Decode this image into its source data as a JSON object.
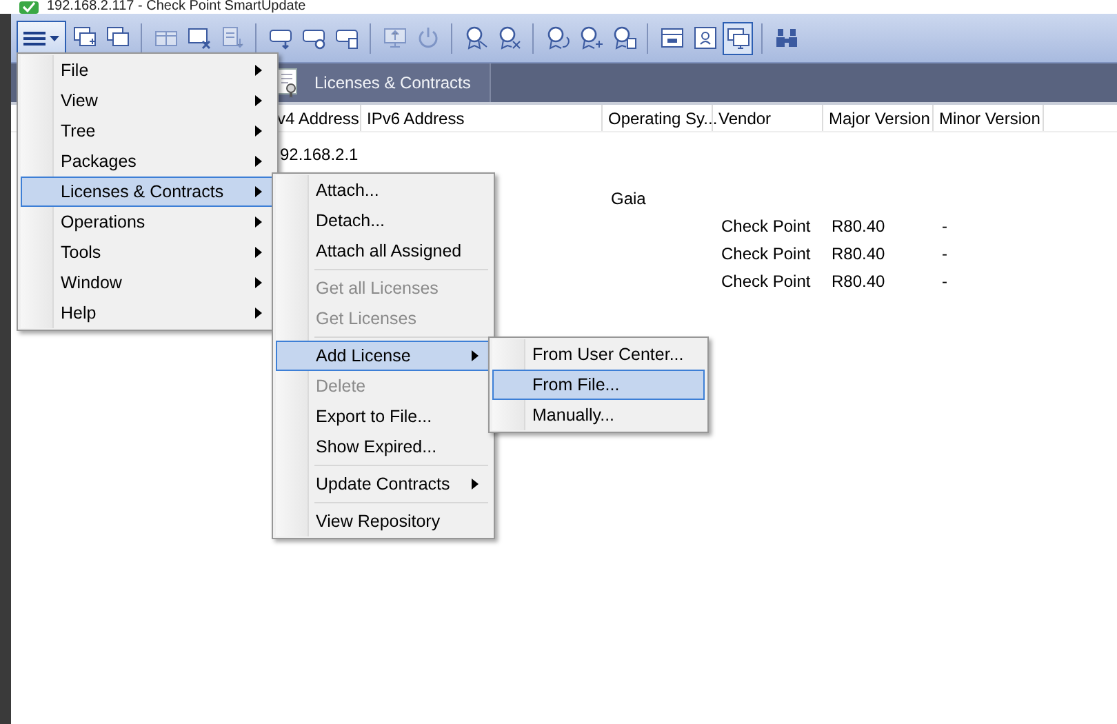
{
  "window": {
    "title": "192.168.2.117 - Check Point SmartUpdate"
  },
  "toolbar": {
    "menu_button": {
      "open": true
    },
    "items": [
      {
        "kind": "button",
        "disabled": false,
        "selected": false
      },
      {
        "kind": "button",
        "disabled": false,
        "selected": false
      },
      {
        "kind": "separator"
      },
      {
        "kind": "button",
        "disabled": true,
        "selected": false
      },
      {
        "kind": "button",
        "disabled": false,
        "selected": false
      },
      {
        "kind": "button",
        "disabled": true,
        "selected": false
      },
      {
        "kind": "separator"
      },
      {
        "kind": "button",
        "disabled": false,
        "selected": false
      },
      {
        "kind": "button",
        "disabled": false,
        "selected": false
      },
      {
        "kind": "button",
        "disabled": false,
        "selected": false
      },
      {
        "kind": "separator"
      },
      {
        "kind": "button",
        "disabled": true,
        "selected": false
      },
      {
        "kind": "button",
        "disabled": true,
        "selected": false
      },
      {
        "kind": "separator"
      },
      {
        "kind": "button",
        "disabled": false,
        "selected": false
      },
      {
        "kind": "button",
        "disabled": false,
        "selected": false
      },
      {
        "kind": "separator"
      },
      {
        "kind": "button",
        "disabled": false,
        "selected": false
      },
      {
        "kind": "button",
        "disabled": false,
        "selected": false
      },
      {
        "kind": "button",
        "disabled": false,
        "selected": false
      },
      {
        "kind": "separator"
      },
      {
        "kind": "button",
        "disabled": false,
        "selected": false
      },
      {
        "kind": "button",
        "disabled": false,
        "selected": false
      },
      {
        "kind": "button",
        "disabled": false,
        "selected": true
      },
      {
        "kind": "separator"
      },
      {
        "kind": "button",
        "disabled": false,
        "selected": false
      }
    ]
  },
  "tabs": [
    {
      "label": "Licenses & Contracts",
      "selected": true
    }
  ],
  "table": {
    "columns": [
      "v4 Address",
      "IPv6 Address",
      "Operating Sy...",
      "Vendor",
      "Major Version",
      "Minor Version"
    ],
    "rows": [
      {
        "ipv4_address": "92.168.2.1"
      },
      {
        "operating_system": "Gaia"
      },
      {
        "vendor": "Check Point",
        "major_version": "R80.40",
        "minor_version": "-"
      },
      {
        "vendor": "Check Point",
        "major_version": "R80.40",
        "minor_version": "-"
      },
      {
        "vendor": "Check Point",
        "major_version": "R80.40",
        "minor_version": "-"
      }
    ]
  },
  "main_menu": {
    "items": [
      {
        "kind": "item",
        "label": "File",
        "has_submenu": true,
        "selected": false,
        "disabled": false
      },
      {
        "kind": "item",
        "label": "View",
        "has_submenu": true,
        "selected": false,
        "disabled": false
      },
      {
        "kind": "item",
        "label": "Tree",
        "has_submenu": true,
        "selected": false,
        "disabled": false
      },
      {
        "kind": "item",
        "label": "Packages",
        "has_submenu": true,
        "selected": false,
        "disabled": false
      },
      {
        "kind": "item",
        "label": "Licenses & Contracts",
        "has_submenu": true,
        "selected": true,
        "disabled": false,
        "submenu": {
          "items": [
            {
              "kind": "item",
              "label": "Attach...",
              "has_submenu": false,
              "selected": false,
              "disabled": false
            },
            {
              "kind": "item",
              "label": "Detach...",
              "has_submenu": false,
              "selected": false,
              "disabled": false
            },
            {
              "kind": "item",
              "label": "Attach all Assigned",
              "has_submenu": false,
              "selected": false,
              "disabled": false
            },
            {
              "kind": "separator"
            },
            {
              "kind": "item",
              "label": "Get all Licenses",
              "has_submenu": false,
              "selected": false,
              "disabled": true
            },
            {
              "kind": "item",
              "label": "Get Licenses",
              "has_submenu": false,
              "selected": false,
              "disabled": true
            },
            {
              "kind": "separator"
            },
            {
              "kind": "item",
              "label": "Add License",
              "has_submenu": true,
              "selected": true,
              "disabled": false,
              "submenu": {
                "items": [
                  {
                    "kind": "item",
                    "label": "From User Center...",
                    "has_submenu": false,
                    "selected": false,
                    "disabled": false
                  },
                  {
                    "kind": "item",
                    "label": "From File...",
                    "has_submenu": false,
                    "selected": true,
                    "disabled": false
                  },
                  {
                    "kind": "item",
                    "label": "Manually...",
                    "has_submenu": false,
                    "selected": false,
                    "disabled": false
                  }
                ]
              }
            },
            {
              "kind": "item",
              "label": "Delete",
              "has_submenu": false,
              "selected": false,
              "disabled": true
            },
            {
              "kind": "item",
              "label": "Export to File...",
              "has_submenu": false,
              "selected": false,
              "disabled": false
            },
            {
              "kind": "item",
              "label": "Show Expired...",
              "has_submenu": false,
              "selected": false,
              "disabled": false
            },
            {
              "kind": "separator"
            },
            {
              "kind": "item",
              "label": "Update Contracts",
              "has_submenu": true,
              "selected": false,
              "disabled": false
            },
            {
              "kind": "separator"
            },
            {
              "kind": "item",
              "label": "View Repository",
              "has_submenu": false,
              "selected": false,
              "disabled": false
            }
          ]
        }
      },
      {
        "kind": "item",
        "label": "Operations",
        "has_submenu": true,
        "selected": false,
        "disabled": false
      },
      {
        "kind": "item",
        "label": "Tools",
        "has_submenu": true,
        "selected": false,
        "disabled": false
      },
      {
        "kind": "item",
        "label": "Window",
        "has_submenu": true,
        "selected": false,
        "disabled": false
      },
      {
        "kind": "item",
        "label": "Help",
        "has_submenu": true,
        "selected": false,
        "disabled": false
      }
    ]
  }
}
